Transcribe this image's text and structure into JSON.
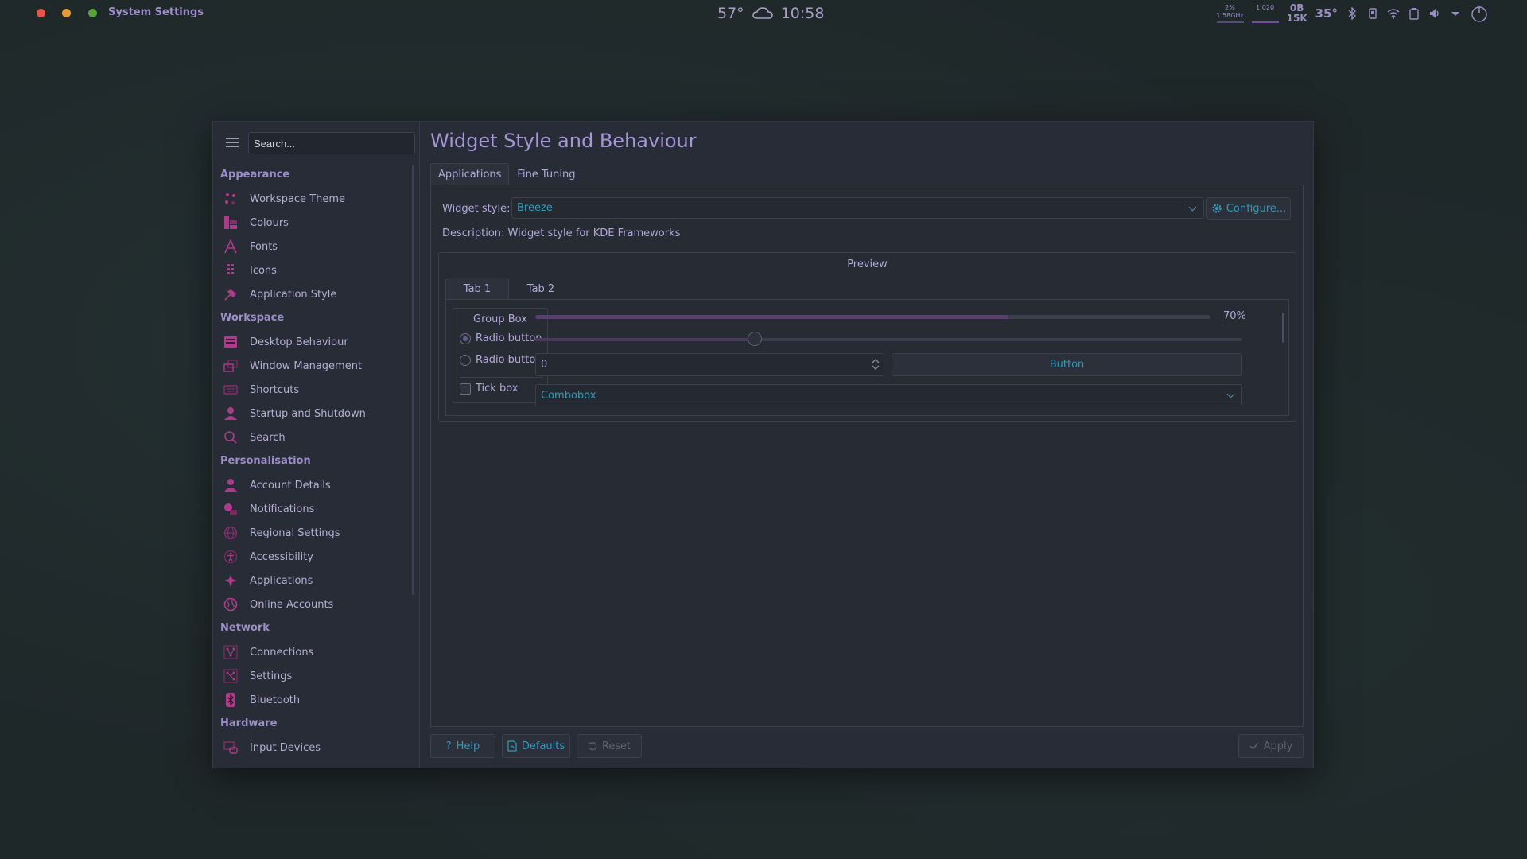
{
  "topbar": {
    "app_title": "System Settings",
    "window_dots": [
      "#e5534b",
      "#e69a3a",
      "#58a33a"
    ],
    "weather_temp": "57°",
    "clock": "10:58",
    "cpu_percent": "2%",
    "cpu_freq": "1.58GHz",
    "load": "1.020",
    "net_up": "0B",
    "net_down": "15K",
    "temperature": "35°"
  },
  "sidebar": {
    "search_placeholder": "Search...",
    "sections": [
      {
        "title": "Appearance",
        "items": [
          {
            "label": "Workspace Theme",
            "icon": "workspace-theme-icon"
          },
          {
            "label": "Colours",
            "icon": "colours-icon"
          },
          {
            "label": "Fonts",
            "icon": "fonts-icon"
          },
          {
            "label": "Icons",
            "icon": "icons-icon"
          },
          {
            "label": "Application Style",
            "icon": "application-style-icon"
          }
        ]
      },
      {
        "title": "Workspace",
        "items": [
          {
            "label": "Desktop Behaviour",
            "icon": "desktop-behaviour-icon"
          },
          {
            "label": "Window Management",
            "icon": "window-management-icon"
          },
          {
            "label": "Shortcuts",
            "icon": "shortcuts-icon"
          },
          {
            "label": "Startup and Shutdown",
            "icon": "startup-shutdown-icon"
          },
          {
            "label": "Search",
            "icon": "search-icon"
          }
        ]
      },
      {
        "title": "Personalisation",
        "items": [
          {
            "label": "Account Details",
            "icon": "account-details-icon"
          },
          {
            "label": "Notifications",
            "icon": "notifications-icon"
          },
          {
            "label": "Regional Settings",
            "icon": "regional-settings-icon"
          },
          {
            "label": "Accessibility",
            "icon": "accessibility-icon"
          },
          {
            "label": "Applications",
            "icon": "applications-icon"
          },
          {
            "label": "Online Accounts",
            "icon": "online-accounts-icon"
          }
        ]
      },
      {
        "title": "Network",
        "items": [
          {
            "label": "Connections",
            "icon": "connections-icon"
          },
          {
            "label": "Settings",
            "icon": "network-settings-icon"
          },
          {
            "label": "Bluetooth",
            "icon": "bluetooth-icon"
          }
        ]
      },
      {
        "title": "Hardware",
        "items": [
          {
            "label": "Input Devices",
            "icon": "input-devices-icon"
          }
        ]
      }
    ]
  },
  "main": {
    "title": "Widget Style and Behaviour",
    "tabs": [
      "Applications",
      "Fine Tuning"
    ],
    "widget_style_label": "Widget style:",
    "widget_style_value": "Breeze",
    "configure_label": "Configure...",
    "description": "Description: Widget style for KDE Frameworks",
    "preview": {
      "title": "Preview",
      "tabs": [
        "Tab 1",
        "Tab 2"
      ],
      "group_box_title": "Group Box",
      "radio1": "Radio button",
      "radio2": "Radio button",
      "tick_box": "Tick box",
      "progress_value": 0.7,
      "progress_label": "70%",
      "slider_value": 0.31,
      "spinbox_value": "0",
      "button_label": "Button",
      "combobox_value": "Combobox"
    }
  },
  "footer": {
    "help": "Help",
    "defaults": "Defaults",
    "reset": "Reset",
    "apply": "Apply"
  },
  "accent": "#9d8ec7",
  "icon_color": "#b03a8a",
  "link_color": "#2f9bbd"
}
